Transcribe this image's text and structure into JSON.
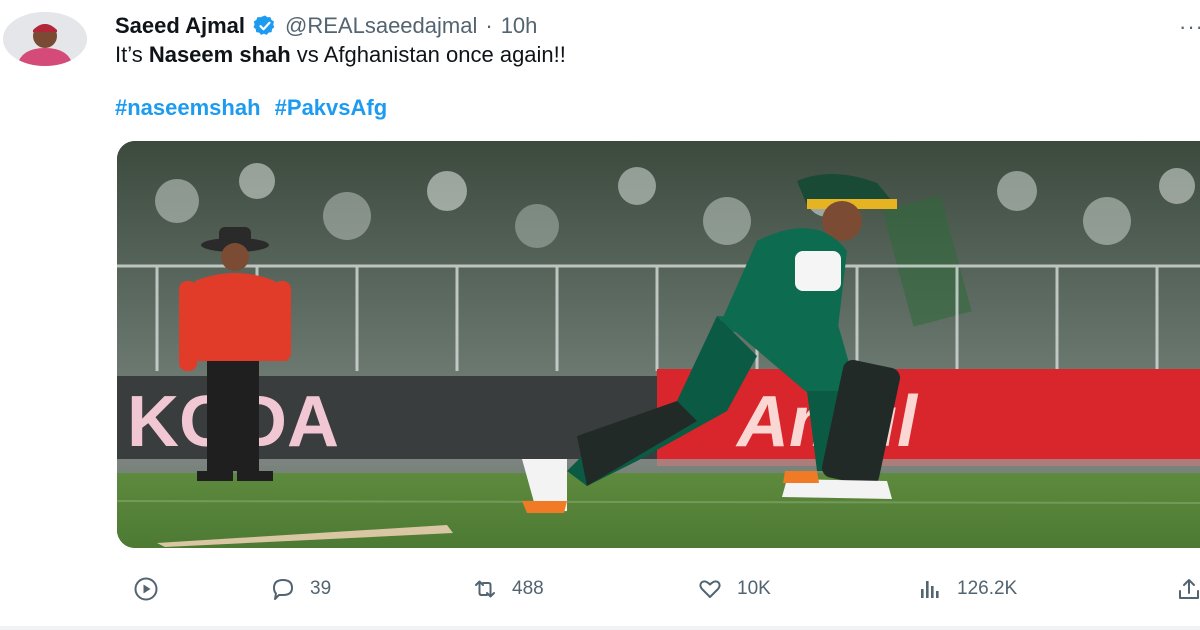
{
  "tweet": {
    "author_name": "Saeed Ajmal",
    "handle": "@REALsaeedajmal",
    "separator": "·",
    "time": "10h",
    "more": "···",
    "text": {
      "pre": "It’s ",
      "bold": "Naseem shah",
      "post": " vs Afghanistan once again!!"
    },
    "hashtags": [
      "#naseemshah",
      "#PakvsAfg"
    ]
  },
  "media": {
    "board_left_text": "KODA",
    "board_right_text": "Amul"
  },
  "actions": {
    "replies": "39",
    "retweets": "488",
    "likes": "10K",
    "views": "126.2K"
  },
  "colors": {
    "link": "#1d9bf0",
    "secondary_text": "#536471",
    "verified_badge": "#1d9bf0"
  },
  "icons": [
    "view-video-icon",
    "reply-icon",
    "retweet-icon",
    "like-icon",
    "views-icon",
    "share-icon",
    "verified-badge-icon",
    "more-icon"
  ]
}
